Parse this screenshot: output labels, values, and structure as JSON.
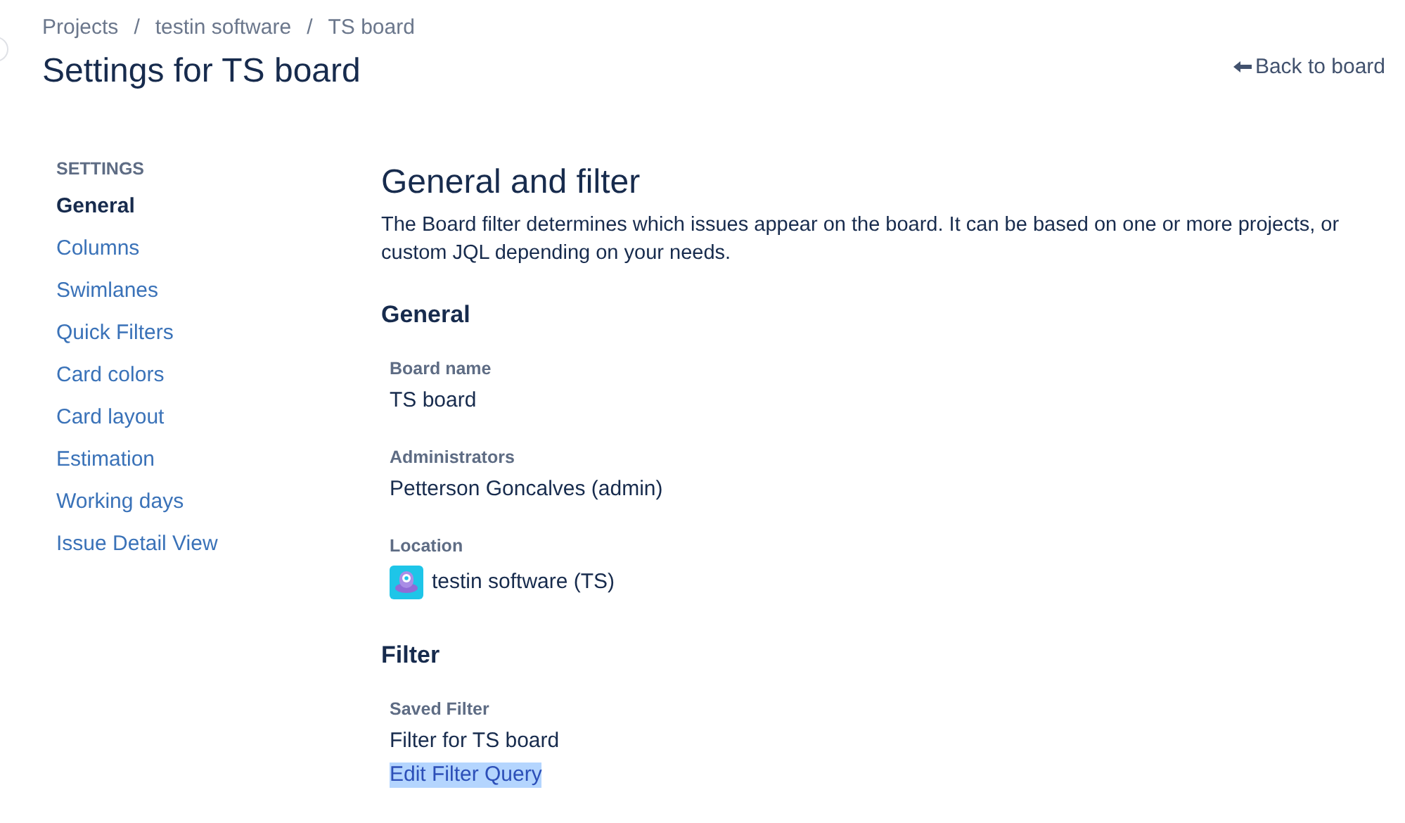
{
  "breadcrumbs": [
    "Projects",
    "testin software",
    "TS board"
  ],
  "breadcrumb_separator": "/",
  "title": "Settings for TS board",
  "back_link": "Back to board",
  "sidebar": {
    "heading": "SETTINGS",
    "items": [
      {
        "label": "General",
        "selected": true
      },
      {
        "label": "Columns",
        "selected": false
      },
      {
        "label": "Swimlanes",
        "selected": false
      },
      {
        "label": "Quick Filters",
        "selected": false
      },
      {
        "label": "Card colors",
        "selected": false
      },
      {
        "label": "Card layout",
        "selected": false
      },
      {
        "label": "Estimation",
        "selected": false
      },
      {
        "label": "Working days",
        "selected": false
      },
      {
        "label": "Issue Detail View",
        "selected": false
      }
    ]
  },
  "main": {
    "heading": "General and filter",
    "description": "The Board filter determines which issues appear on the board. It can be based on one or more projects, or custom JQL depending on your needs.",
    "sections": [
      {
        "title": "General",
        "fields": [
          {
            "label": "Board name",
            "value": "TS board",
            "kind": "text"
          },
          {
            "label": "Administrators",
            "value": "Petterson Goncalves (admin)",
            "kind": "text"
          },
          {
            "label": "Location",
            "value": "testin software (TS)",
            "kind": "project"
          }
        ]
      },
      {
        "title": "Filter",
        "fields": [
          {
            "label": "Saved Filter",
            "value": "Filter for TS board",
            "kind": "text",
            "link": {
              "label": "Edit Filter Query",
              "highlighted": true
            }
          }
        ]
      }
    ]
  }
}
